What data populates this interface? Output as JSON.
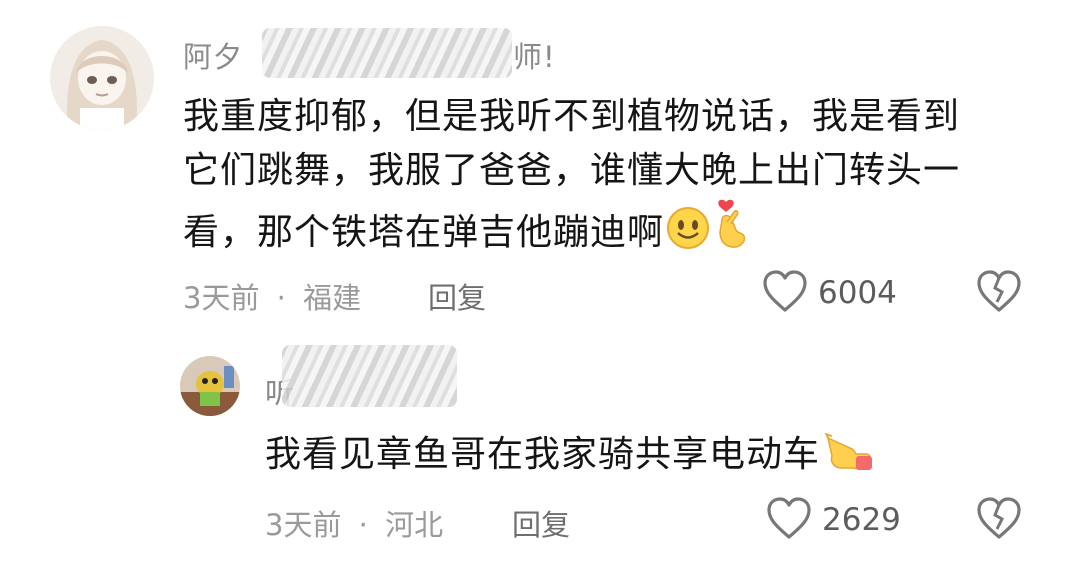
{
  "comments": [
    {
      "username_start": "阿夕",
      "username_end": "师!",
      "text_lines": [
        "我重度抑郁，但是我听不到植物说话，我是看到",
        "它们跳舞，我服了爸爸，谁懂大晚上出门转头一",
        "看，那个铁塔在弹吉他蹦迪啊"
      ],
      "emoji": [
        "smile-emoji",
        "crossed-fingers-heart-emoji"
      ],
      "time": "3天前",
      "sep": "·",
      "location": "福建",
      "reply_label": "回复",
      "likes": "6004"
    },
    {
      "username_start": "听",
      "username_end": "",
      "text": "我看见章鱼哥在我家骑共享电动车",
      "emoji": [
        "pointing-hand-emoji"
      ],
      "time": "3天前",
      "sep": "·",
      "location": "河北",
      "reply_label": "回复",
      "likes": "2629"
    }
  ]
}
